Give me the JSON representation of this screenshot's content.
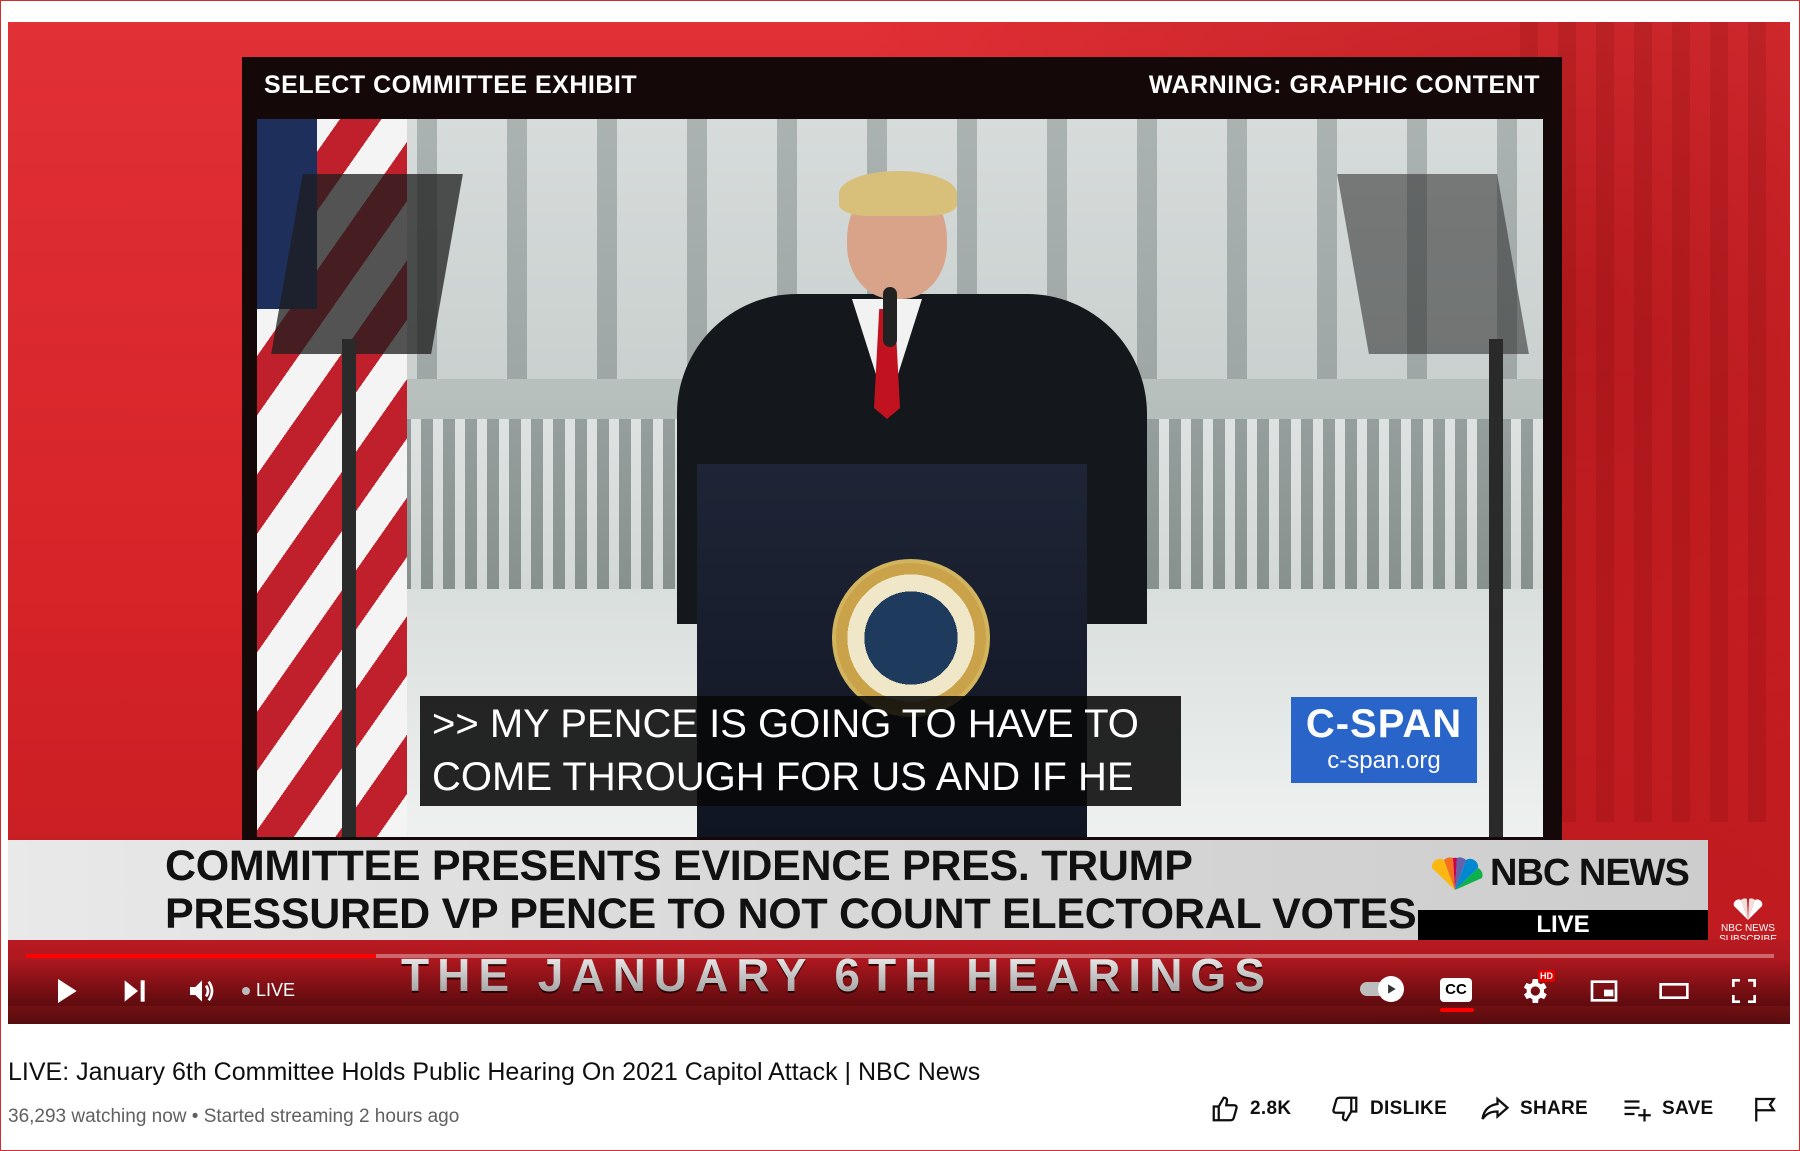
{
  "player": {
    "exhibit_label": "SELECT COMMITTEE EXHIBIT",
    "warning_label": "WARNING: GRAPHIC CONTENT",
    "captions": [
      ">> MY PENCE IS GOING TO HAVE TO",
      "COME THROUGH FOR US AND IF HE"
    ],
    "cspan": {
      "name": "C-SPAN",
      "url": "c-span.org"
    },
    "headline": [
      "COMMITTEE PRESENTS EVIDENCE PRES. TRUMP",
      "PRESSURED VP PENCE TO NOT COUNT ELECTORAL VOTES"
    ],
    "network": {
      "name": "NBC NEWS",
      "live": "LIVE",
      "corner": "NBC NEWS SUBSCRIBE"
    },
    "band_text": "THE JANUARY 6TH HEARINGS",
    "progress": 0.2,
    "controls": {
      "live_label": "LIVE",
      "cc_label": "CC",
      "hd_badge": "HD",
      "icons": [
        "play-icon",
        "next-icon",
        "volume-icon",
        "autoplay-toggle",
        "settings-icon",
        "miniplayer-icon",
        "theater-icon",
        "fullscreen-icon"
      ]
    }
  },
  "video": {
    "title": "LIVE: January 6th Committee Holds Public Hearing On 2021 Capitol Attack | NBC News",
    "meta": "36,293 watching now • Started streaming 2 hours ago"
  },
  "actions": {
    "like_count": "2.8K",
    "dislike_label": "DISLIKE",
    "share_label": "SHARE",
    "save_label": "SAVE"
  },
  "colors": {
    "accent": "#ff0000",
    "background_red": "#d8252b",
    "cspan_blue": "#1a59c7",
    "text": "#0f0f0f",
    "muted": "#606060"
  }
}
